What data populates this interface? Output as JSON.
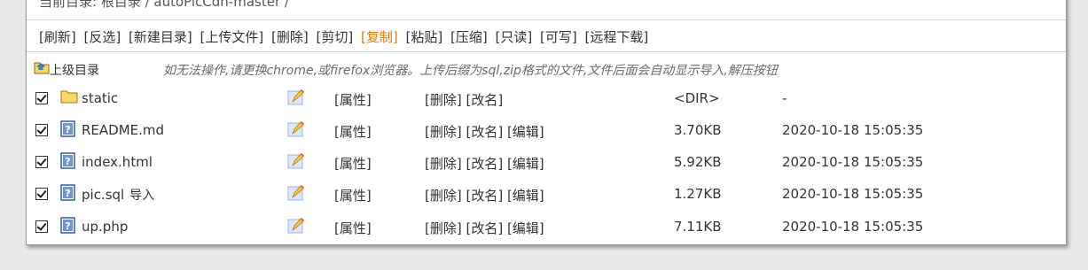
{
  "breadcrumb": "当前目录: 根目录 / autoPicCdn-master /",
  "toolbar": {
    "items": [
      "[刷新]",
      "[反选]",
      "[新建目录]",
      "[上传文件]",
      "[删除]",
      "[剪切]",
      "[复制]",
      "[粘贴]",
      "[压缩]",
      "[只读]",
      "[可写]",
      "[远程下载]"
    ],
    "highlight_color": "#e07c13"
  },
  "up": {
    "label": "上级目录",
    "hint": "如无法操作,请更换chrome,或firefox浏览器。上传后缀为sql,zip格式的文件,文件后面会自动显示导入,解压按钮"
  },
  "files": [
    {
      "name": "static",
      "icon": "folder-icon",
      "import": "",
      "attr": "[属性]",
      "ops": "[删除] [改名]",
      "size": "<DIR>",
      "date": "-"
    },
    {
      "name": "README.md",
      "icon": "file-icon",
      "import": "",
      "attr": "[属性]",
      "ops": "[删除] [改名] [编辑]",
      "size": "3.70KB",
      "date": "2020-10-18 15:05:35"
    },
    {
      "name": "index.html",
      "icon": "file-icon",
      "import": "",
      "attr": "[属性]",
      "ops": "[删除] [改名] [编辑]",
      "size": "5.92KB",
      "date": "2020-10-18 15:05:35"
    },
    {
      "name": "pic.sql",
      "icon": "file-icon",
      "import": "导入",
      "attr": "[属性]",
      "ops": "[删除] [改名] [编辑]",
      "size": "1.27KB",
      "date": "2020-10-18 15:05:35"
    },
    {
      "name": "up.php",
      "icon": "file-icon",
      "import": "",
      "attr": "[属性]",
      "ops": "[删除] [改名] [编辑]",
      "size": "7.11KB",
      "date": "2020-10-18 15:05:35"
    }
  ]
}
